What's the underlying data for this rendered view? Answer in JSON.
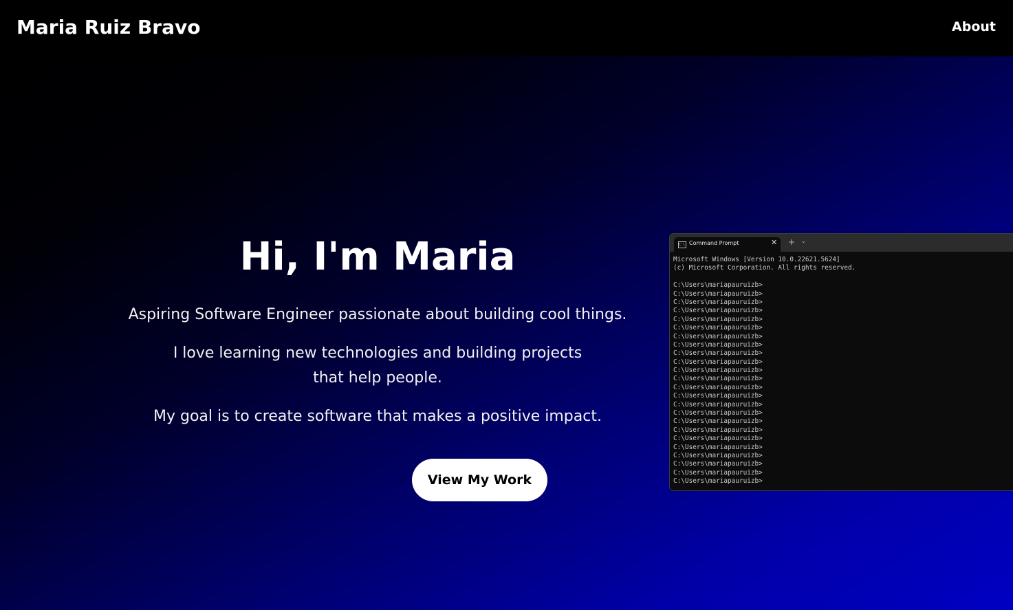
{
  "navbar": {
    "brand": "Maria Ruiz Bravo",
    "links": [
      {
        "label": "About"
      }
    ]
  },
  "hero": {
    "title": "Hi, I'm Maria",
    "paragraphs": [
      "Aspiring Software Engineer passionate about building cool things.",
      "I love learning new technologies and building projects that help people.",
      "My goal is to create software that makes a positive impact."
    ],
    "cta_label": "View My Work"
  },
  "terminal": {
    "tab_title": "Command Prompt",
    "tab_icon_text": "C:\\",
    "close_glyph": "✕",
    "new_tab_glyph": "+",
    "dropdown_glyph": "⌄",
    "header_lines": [
      "Microsoft Windows [Version 10.0.22621.5624]",
      "(c) Microsoft Corporation. All rights reserved.",
      ""
    ],
    "prompt_lines": [
      "C:\\Users\\mariapauruizb>",
      "C:\\Users\\mariapauruizb>",
      "C:\\Users\\mariapauruizb>",
      "C:\\Users\\mariapauruizb>",
      "C:\\Users\\mariapauruizb>",
      "C:\\Users\\mariapauruizb>",
      "C:\\Users\\mariapauruizb>",
      "C:\\Users\\mariapauruizb>",
      "C:\\Users\\mariapauruizb>",
      "C:\\Users\\mariapauruizb>",
      "C:\\Users\\mariapauruizb>",
      "C:\\Users\\mariapauruizb>",
      "C:\\Users\\mariapauruizb>",
      "C:\\Users\\mariapauruizb>",
      "C:\\Users\\mariapauruizb>",
      "C:\\Users\\mariapauruizb>",
      "C:\\Users\\mariapauruizb>",
      "C:\\Users\\mariapauruizb>",
      "C:\\Users\\mariapauruizb>",
      "C:\\Users\\mariapauruizb>",
      "C:\\Users\\mariapauruizb>",
      "C:\\Users\\mariapauruizb>",
      "C:\\Users\\mariapauruizb>",
      "C:\\Users\\mariapauruizb>"
    ]
  },
  "colors": {
    "nav_bg": "#000000",
    "hero_gradient_start": "#000000",
    "hero_gradient_end": "#0000c2",
    "button_bg": "#ffffff",
    "terminal_bg": "#0c0c0c",
    "terminal_text": "#cccccc"
  }
}
